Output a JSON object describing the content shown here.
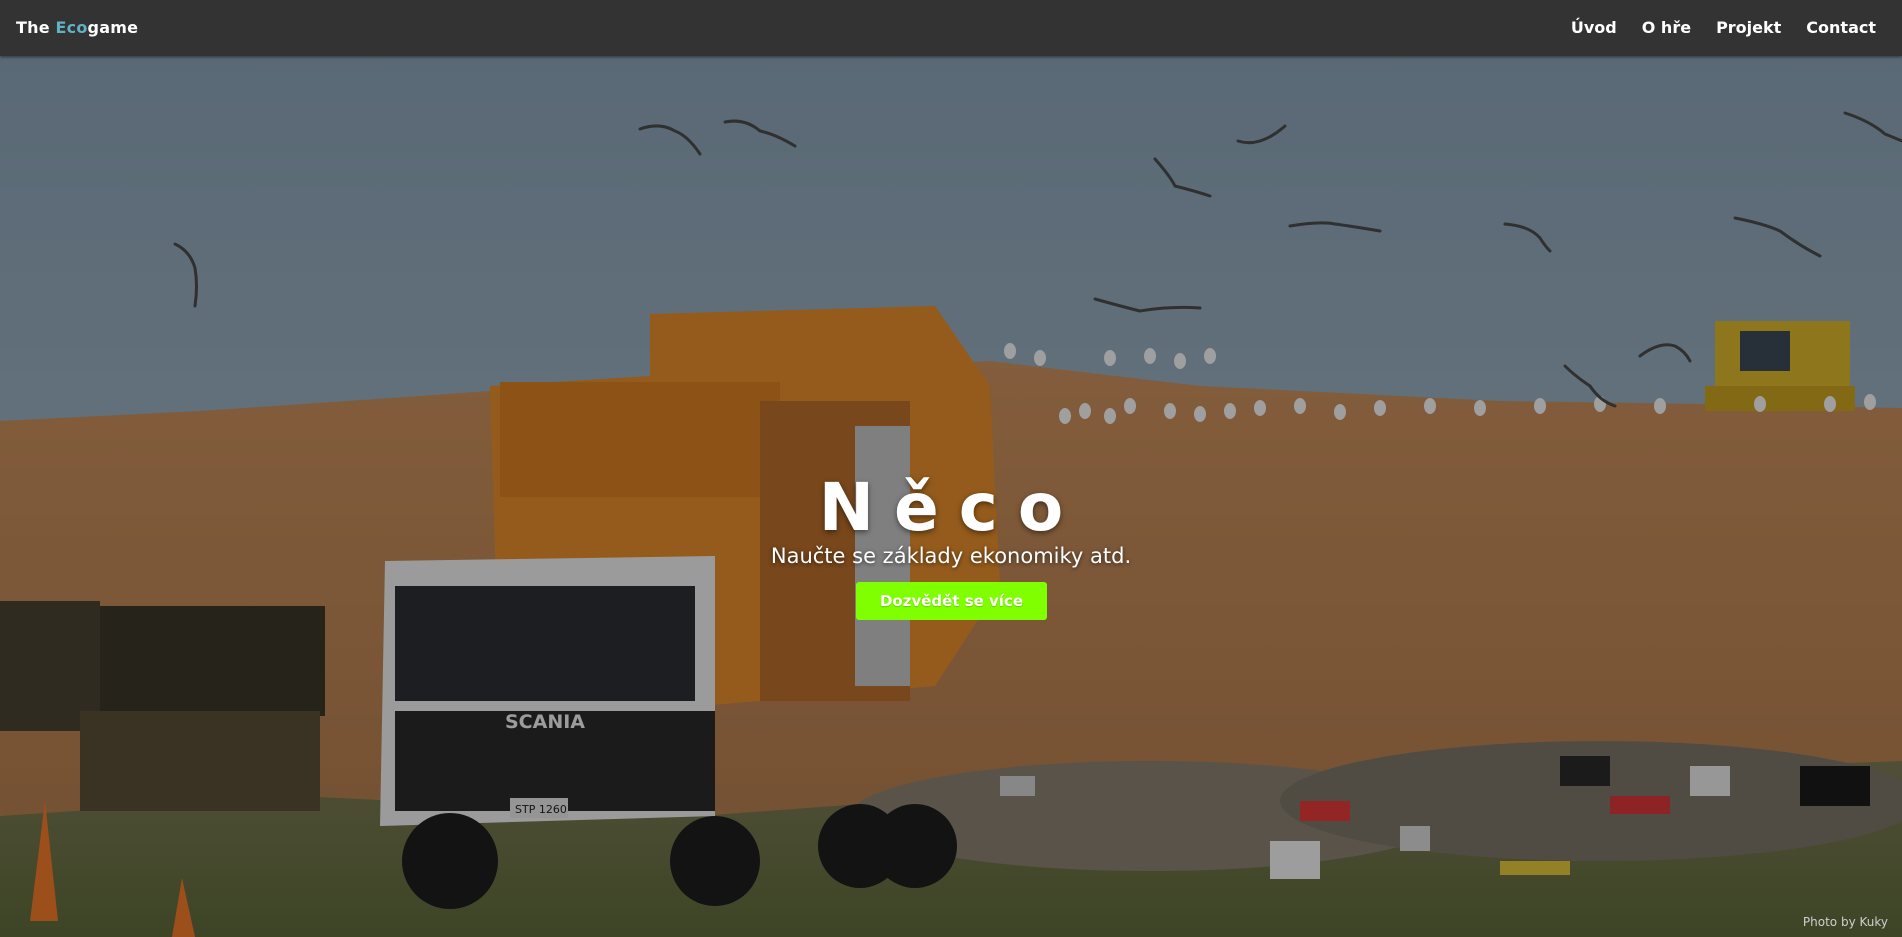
{
  "navbar": {
    "brand_prefix": "The ",
    "brand_highlight": "Eco",
    "brand_suffix": "game",
    "links": [
      {
        "label": "Úvod"
      },
      {
        "label": "O hře"
      },
      {
        "label": "Projekt"
      },
      {
        "label": "Contact"
      }
    ]
  },
  "hero": {
    "title": "Něco",
    "subtitle": "Naučte se základy ekonomiky atd.",
    "cta_label": "Dozvědět se více",
    "photo_credit": "Photo by Kuky",
    "truck_brand": "SCANIA",
    "truck_plate": "STP 1260"
  },
  "colors": {
    "navbar_bg": "#333333",
    "brand_accent": "#5fb3c4",
    "cta_bg": "#7fff00"
  }
}
